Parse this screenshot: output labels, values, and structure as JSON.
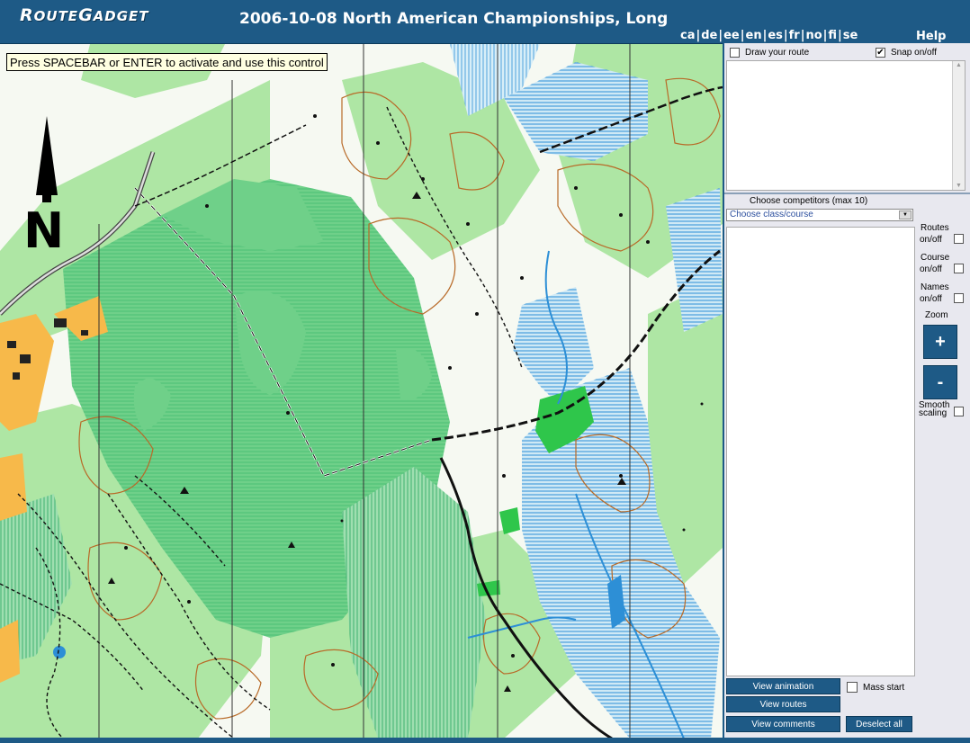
{
  "header": {
    "logo_part1": "R",
    "logo_part2": "OUTE",
    "logo_part3": "G",
    "logo_part4": "ADGET",
    "title": "2006-10-08 North American Championships, Long",
    "languages": [
      "ca",
      "de",
      "ee",
      "en",
      "es",
      "fr",
      "no",
      "fi",
      "se"
    ],
    "help": "Help"
  },
  "map": {
    "tooltip": "Press SPACEBAR or ENTER to activate and use this control",
    "north_label": "N",
    "colors": {
      "white_forest": "#f6f9f2",
      "light_green": "#aee6a4",
      "medium_green": "#6fd089",
      "dark_green": "#2fc64b",
      "marsh_blue": "#2d8fd6",
      "contour": "#b86a28",
      "yellow": "#f7b94a",
      "black": "#111111"
    }
  },
  "panel": {
    "draw_route": "Draw your route",
    "snap": "Snap on/off",
    "snap_checked": "✔",
    "choose_competitors": "Choose competitors (max 10)",
    "choose_class": "Choose class/course",
    "routes_label": "Routes",
    "course_label": "Course",
    "names_label": "Names",
    "onoff": "on/off",
    "zoom": "Zoom",
    "zoom_in": "+",
    "zoom_out": "-",
    "smooth_1": "Smooth",
    "smooth_2": "scaling",
    "view_animation": "View animation",
    "mass_start": "Mass start",
    "view_routes": "View routes",
    "view_comments": "View comments",
    "deselect_all": "Deselect all"
  }
}
